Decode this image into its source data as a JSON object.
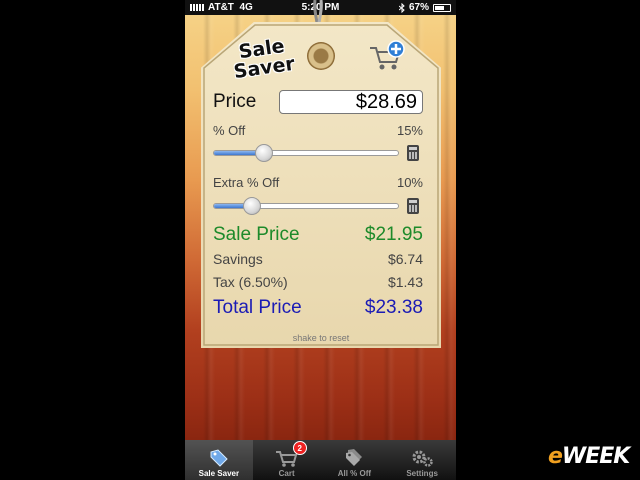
{
  "status_bar": {
    "carrier": "AT&T",
    "network": "4G",
    "time": "5:20 PM",
    "battery": "67%"
  },
  "app": {
    "logo_line1": "Sale",
    "logo_line2": "Saver"
  },
  "price": {
    "label": "Price",
    "value": "$28.69"
  },
  "percent_off": {
    "label": "% Off",
    "value": "15%",
    "slider_fraction": 0.15
  },
  "extra_off": {
    "label": "Extra % Off",
    "value": "10%",
    "slider_fraction": 0.1
  },
  "results": {
    "sale_label": "Sale Price",
    "sale_value": "$21.95",
    "savings_label": "Savings",
    "savings_value": "$6.74",
    "tax_label": "Tax (6.50%)",
    "tax_value": "$1.43",
    "total_label": "Total Price",
    "total_value": "$23.38"
  },
  "hint": "shake to reset",
  "tabs": [
    {
      "label": "Sale Saver",
      "icon": "tag-icon",
      "active": true
    },
    {
      "label": "Cart",
      "icon": "cart-icon",
      "badge": "2"
    },
    {
      "label": "All % Off",
      "icon": "tags-icon"
    },
    {
      "label": "Settings",
      "icon": "gear-icon"
    }
  ],
  "watermark": {
    "prefix": "e",
    "rest": "WEEK"
  },
  "colors": {
    "sale": "#1d8a2a",
    "total": "#1b1bb5",
    "slider": "#3d77cf"
  }
}
